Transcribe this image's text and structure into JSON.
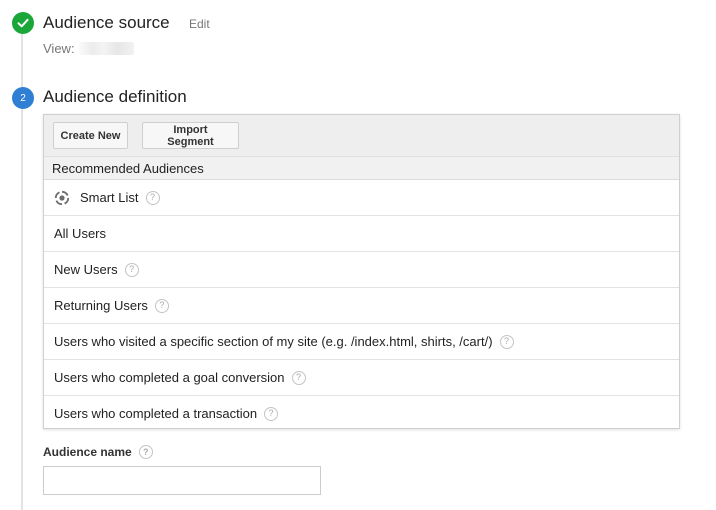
{
  "steps": [
    {
      "status": "complete",
      "icon": "checkmark-icon",
      "title": "Audience source",
      "edit_label": "Edit",
      "view_label": "View:"
    },
    {
      "number": "2",
      "title": "Audience definition"
    }
  ],
  "toolbar": {
    "create_new_label": "Create New",
    "import_segment_label": "Import Segment"
  },
  "recommended": {
    "header": "Recommended Audiences",
    "items": [
      {
        "label": "Smart List",
        "help": true,
        "icon": "smart-list-icon"
      },
      {
        "label": "All Users",
        "help": false
      },
      {
        "label": "New Users",
        "help": true
      },
      {
        "label": "Returning Users",
        "help": true
      },
      {
        "label": "Users who visited a specific section of my site (e.g. /index.html, shirts, /cart/)",
        "help": true
      },
      {
        "label": "Users who completed a goal conversion",
        "help": true
      },
      {
        "label": "Users who completed a transaction",
        "help": true
      }
    ]
  },
  "audience_name": {
    "label": "Audience name",
    "value": "",
    "placeholder": ""
  },
  "help_glyph": "?",
  "colors": {
    "complete_green": "#1ba63a",
    "step_blue": "#2f7fd4",
    "toolbar_bg": "#eeeeee"
  }
}
